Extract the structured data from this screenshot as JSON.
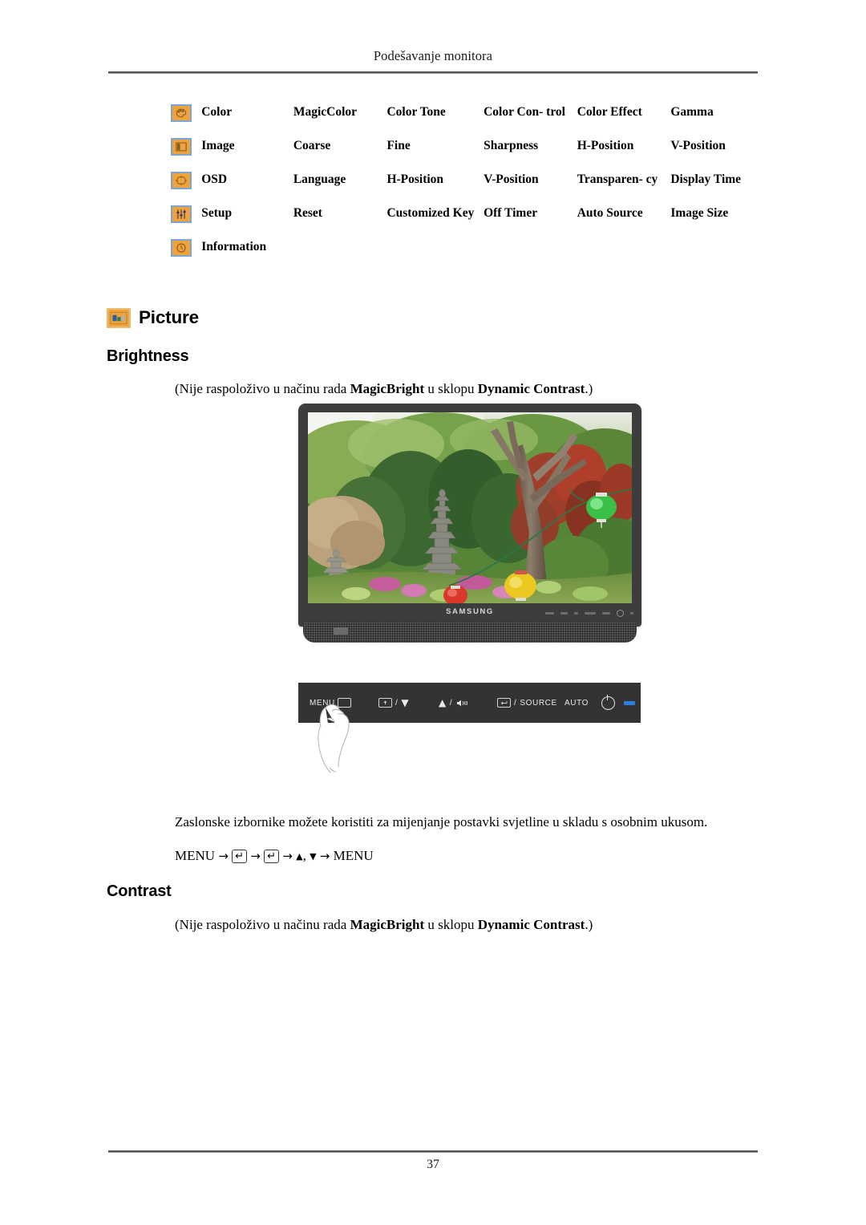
{
  "header": {
    "title": "Podešavanje monitora"
  },
  "footer": {
    "page_number": "37"
  },
  "menu_table": {
    "rows": [
      {
        "icon": "color-palette-icon",
        "category": "Color",
        "items": [
          "MagicColor",
          "Color Tone",
          "Color Con-\ntrol",
          "Color Effect",
          "Gamma"
        ]
      },
      {
        "icon": "image-frame-icon",
        "category": "Image",
        "items": [
          "Coarse",
          "Fine",
          "Sharpness",
          "H-Position",
          "V-Position"
        ]
      },
      {
        "icon": "osd-window-icon",
        "category": "OSD",
        "items": [
          "Language",
          "H-Position",
          "V-Position",
          "Transparen-\ncy",
          "Display Time"
        ]
      },
      {
        "icon": "sliders-setup-icon",
        "category": "Setup",
        "items": [
          "Reset",
          "Customized\nKey",
          "Off Timer",
          "Auto Source",
          "Image Size"
        ]
      },
      {
        "icon": "information-clock-icon",
        "category": "Information",
        "items": [
          "",
          "",
          "",
          "",
          ""
        ]
      }
    ]
  },
  "sections": {
    "picture_heading": "Picture",
    "picture_icon": "picture-icon",
    "brightness_heading": "Brightness",
    "contrast_heading": "Contrast",
    "note_brightness_pre": "(Nije raspoloživo u načinu rada ",
    "note_bold1": "MagicBright",
    "note_mid": " u sklopu ",
    "note_bold2": "Dynamic Contrast",
    "note_post": ".)",
    "description": "Zaslonske izbornike možete koristiti za mijenjanje postavki svjetline u skladu s osobnim ukusom.",
    "menu_path": {
      "start": "MENU",
      "arrow": "→",
      "enter_key": "↵",
      "up_triangle": "▲",
      "comma": ",",
      "down_triangle": "▼",
      "end": "MENU"
    }
  },
  "monitor": {
    "brand": "SAMSUNG",
    "screen_alt": "garden-photo-pagoda-lanterns"
  },
  "control_panel": {
    "buttons": [
      {
        "label": "MENU",
        "icon": "menu-box-icon"
      },
      {
        "label": "/",
        "icon": "brightness-down-icon",
        "glyph": "▼"
      },
      {
        "label": "/",
        "icon": "volume-up-icon",
        "glyph": "▲"
      },
      {
        "label": "SOURCE",
        "icon": "enter-source-icon"
      },
      {
        "label": "AUTO",
        "icon": "auto-button"
      },
      {
        "label": "",
        "icon": "power-icon"
      },
      {
        "label": "",
        "icon": "power-led-indicator"
      }
    ],
    "accent_color": "#2a7fe0",
    "strip_color": "#333333"
  },
  "colors": {
    "icon_fill": "#f0a33c",
    "icon_border": "#7aa6d2",
    "rule": "#555555"
  }
}
